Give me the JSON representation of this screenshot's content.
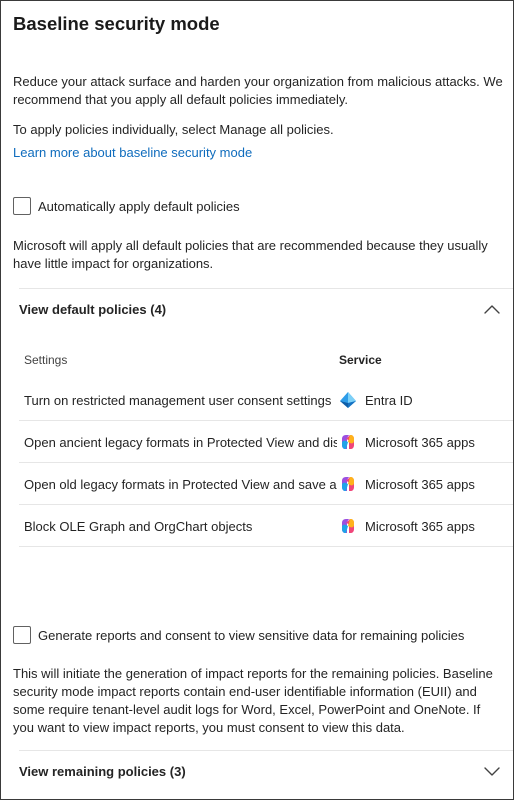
{
  "title": "Baseline security mode",
  "intro": "Reduce your attack surface and harden your organization from malicious attacks. We recommend that you apply all default policies immediately.",
  "apply_hint": "To apply policies individually, select Manage all policies.",
  "learn_more": "Learn more about baseline security mode",
  "auto_apply": {
    "label": "Automatically apply default policies",
    "checked": false
  },
  "auto_apply_desc": "Microsoft will apply all default policies that are recommended because they usually have little impact for organizations.",
  "default_policies": {
    "header": "View default policies (4)",
    "expanded": true,
    "columns": {
      "settings": "Settings",
      "service": "Service"
    },
    "rows": [
      {
        "setting": "Turn on restricted management user consent settings",
        "service": "Entra ID",
        "icon": "entra-id-icon"
      },
      {
        "setting": "Open ancient legacy formats in Protected View and disallow editing",
        "service": "Microsoft 365 apps",
        "icon": "microsoft-365-icon"
      },
      {
        "setting": "Open old legacy formats in Protected View and save as modern format",
        "service": "Microsoft 365 apps",
        "icon": "microsoft-365-icon"
      },
      {
        "setting": "Block OLE Graph and OrgChart objects",
        "service": "Microsoft 365 apps",
        "icon": "microsoft-365-icon"
      }
    ]
  },
  "reports": {
    "label": "Generate reports and consent to view sensitive data for remaining policies",
    "checked": false
  },
  "reports_desc": "This will initiate the generation of impact reports for the remaining policies. Baseline security mode impact reports contain end-user identifiable information (EUII) and some require tenant-level audit logs for Word, Excel, PowerPoint and OneNote. If you want to view impact reports, you must consent to view this data.",
  "remaining_policies": {
    "header": "View remaining policies (3)",
    "expanded": false
  },
  "colors": {
    "link": "#0f6cbd",
    "text": "#242424",
    "divider": "#e6e6e6"
  }
}
